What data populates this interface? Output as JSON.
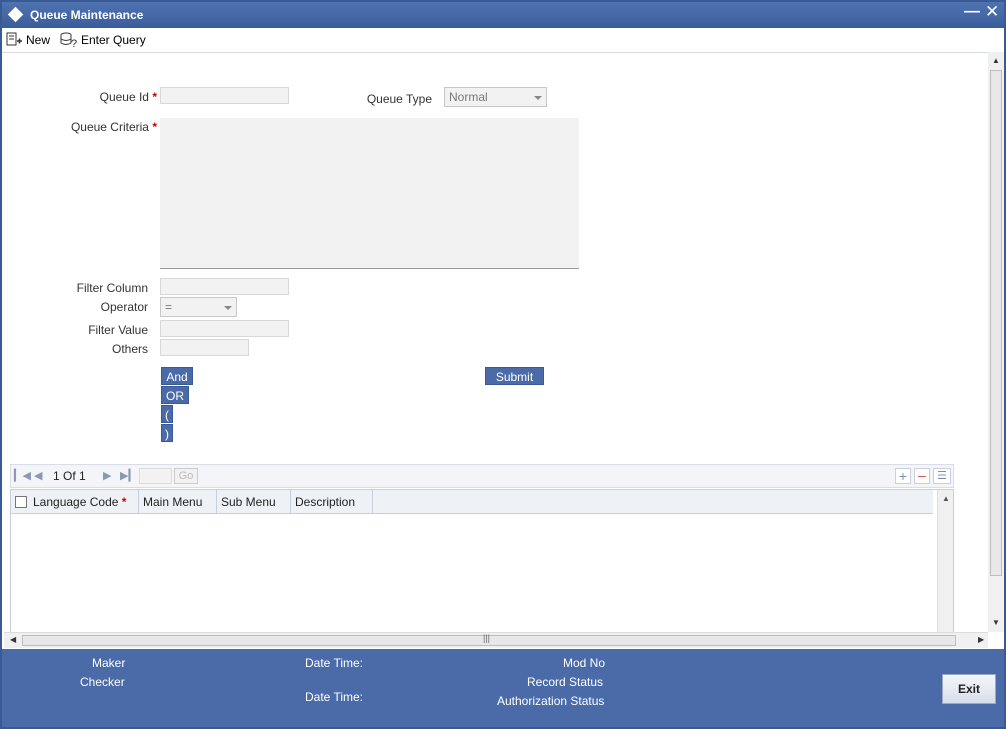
{
  "window": {
    "title": "Queue Maintenance",
    "minimize_icon": "minimize-icon",
    "close_icon": "close-icon"
  },
  "toolbar": {
    "new_label": "New",
    "enter_query_label": "Enter Query"
  },
  "form": {
    "queue_id_label": "Queue Id",
    "queue_id_value": "",
    "queue_type_label": "Queue Type",
    "queue_type_value": "Normal",
    "queue_criteria_label": "Queue Criteria",
    "queue_criteria_value": "",
    "filter_column_label": "Filter Column",
    "filter_column_value": "",
    "operator_label": "Operator",
    "operator_value": "=",
    "filter_value_label": "Filter Value",
    "filter_value_value": "",
    "others_label": "Others",
    "others_value": "",
    "required_marker": "*"
  },
  "criteria_buttons": {
    "and": "And",
    "or": "OR",
    "open_paren": "(",
    "close_paren": ")",
    "submit": "Submit"
  },
  "grid": {
    "page_current": "1",
    "page_of": "Of",
    "page_total": "1",
    "go_label": "Go",
    "columns": [
      "Language Code",
      "Main Menu",
      "Sub Menu",
      "Description"
    ],
    "rows": []
  },
  "footer": {
    "maker_label": "Maker",
    "checker_label": "Checker",
    "date_time_label_1": "Date Time:",
    "date_time_label_2": "Date Time:",
    "mod_no_label": "Mod No",
    "record_status_label": "Record Status",
    "authorization_status_label": "Authorization Status",
    "exit_label": "Exit"
  },
  "colors": {
    "brand_blue": "#4a6ba8",
    "title_bar": "#3a5c9b",
    "required": "#cc0000"
  }
}
